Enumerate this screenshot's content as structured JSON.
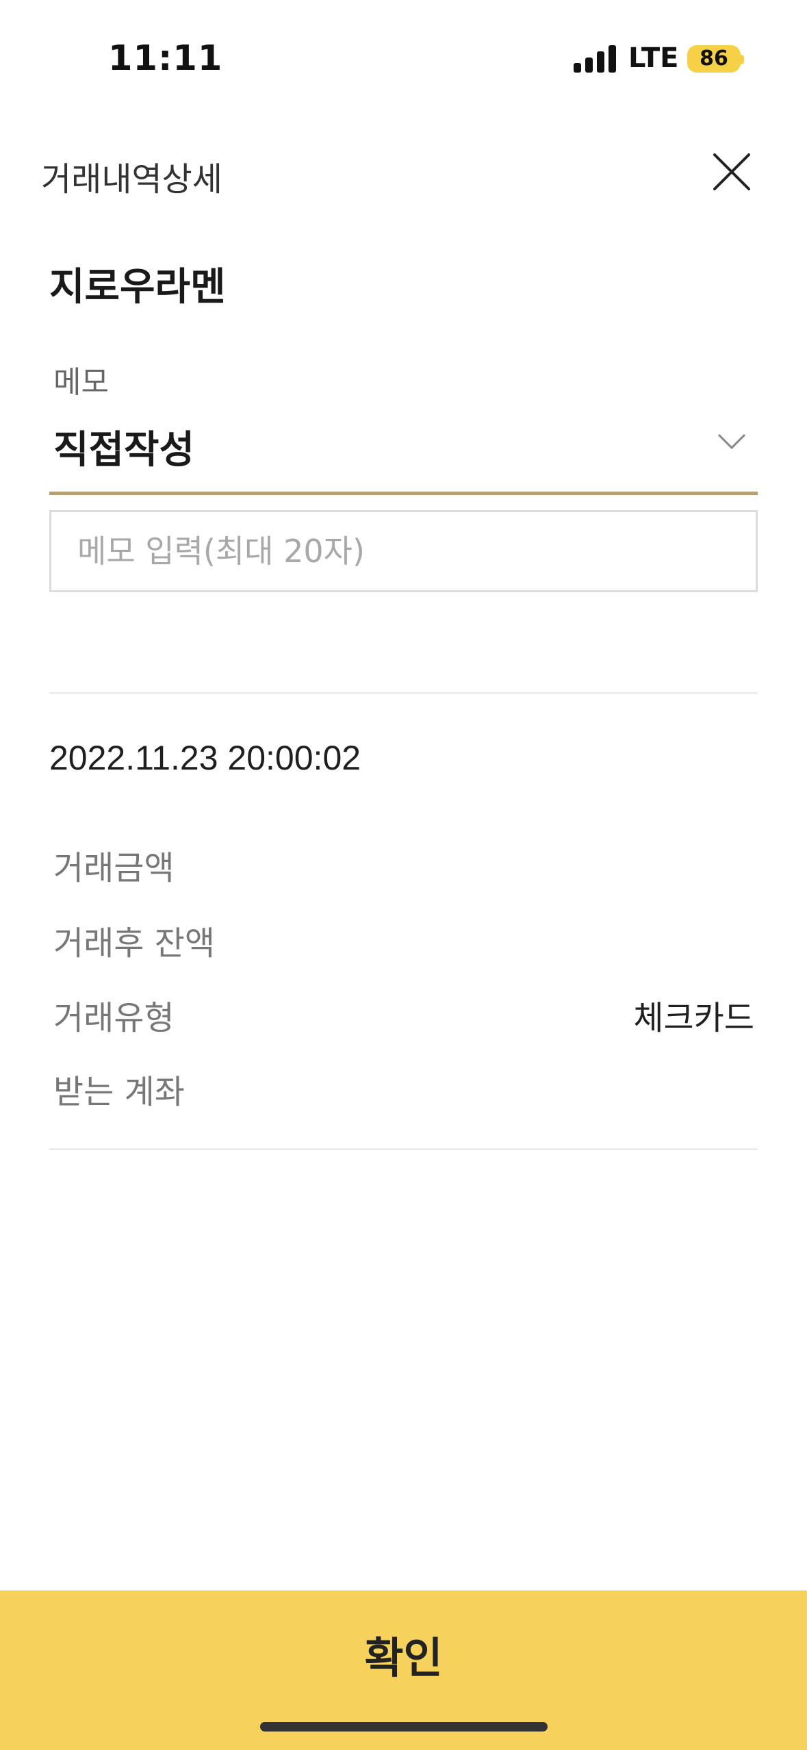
{
  "status_bar": {
    "time": "11:11",
    "network": "LTE",
    "battery": "86"
  },
  "header": {
    "title": "거래내역상세"
  },
  "merchant": {
    "name": "지로우라멘"
  },
  "memo": {
    "label": "메모",
    "selected": "직접작성",
    "input_placeholder": "메모 입력(최대 20자)",
    "input_value": ""
  },
  "transaction": {
    "datetime": "2022.11.23 20:00:02",
    "rows": [
      {
        "label": "거래금액",
        "value": ""
      },
      {
        "label": "거래후 잔액",
        "value": ""
      },
      {
        "label": "거래유형",
        "value": "체크카드"
      },
      {
        "label": "받는 계좌",
        "value": ""
      }
    ]
  },
  "footer": {
    "confirm_label": "확인"
  },
  "colors": {
    "accent_yellow": "#f6d15c",
    "select_underline": "#b59f73",
    "battery": "#f6d046"
  }
}
